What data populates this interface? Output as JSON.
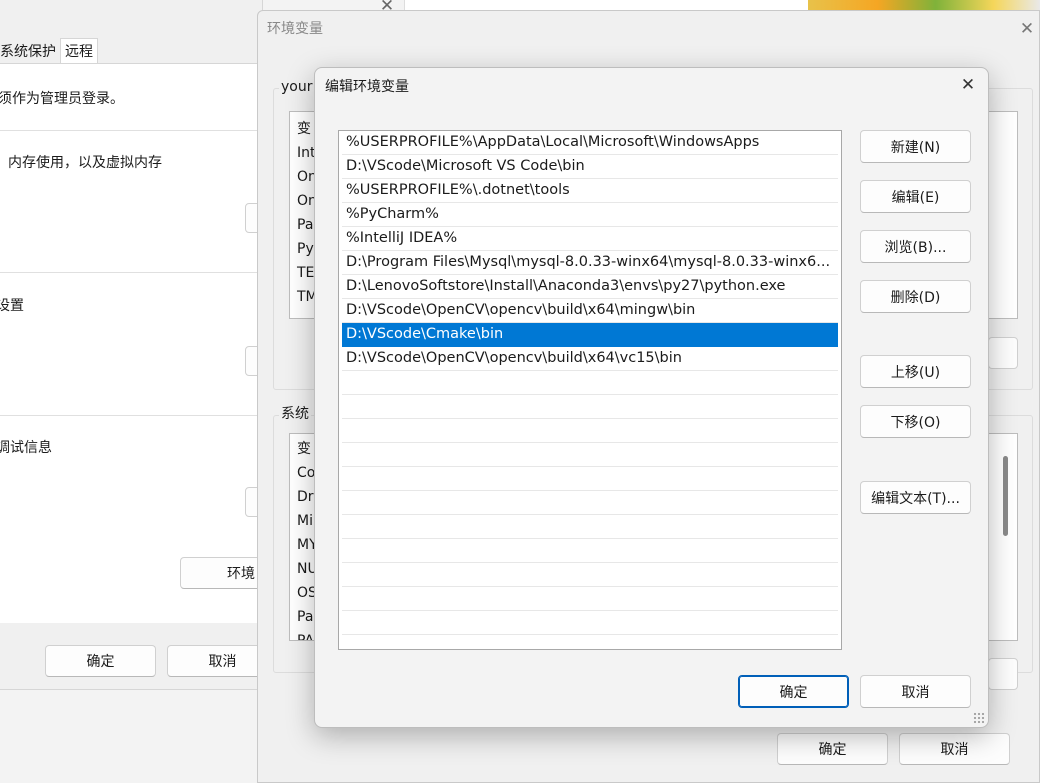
{
  "system_properties": {
    "tabs": [
      "系统保护",
      "远程"
    ],
    "admin_notice": "须作为管理员登录。",
    "performance_text": "内存使用，以及虚拟内存",
    "profiles_text": "设置",
    "startup_text": "调试信息",
    "env_button": "环境",
    "ok": "确定",
    "cancel": "取消"
  },
  "environment_variables": {
    "title": "环境变量",
    "user_group_label": "your",
    "user_vars_header": "变",
    "user_vars": [
      "Int",
      "On",
      "On",
      "Pa",
      "Py",
      "TE",
      "TM"
    ],
    "system_group_label": "系统",
    "system_vars_header": "变",
    "system_vars": [
      "Co",
      "Dr",
      "Mi",
      "MY",
      "NU",
      "OS",
      "Pa",
      "PA"
    ],
    "ok": "确定",
    "cancel": "取消"
  },
  "edit_dialog": {
    "title": "编辑环境变量",
    "paths": [
      "%USERPROFILE%\\AppData\\Local\\Microsoft\\WindowsApps",
      "D:\\VScode\\Microsoft VS Code\\bin",
      "%USERPROFILE%\\.dotnet\\tools",
      "%PyCharm%",
      "%IntelliJ IDEA%",
      "D:\\Program Files\\Mysql\\mysql-8.0.33-winx64\\mysql-8.0.33-winx6...",
      "D:\\LenovoSoftstore\\Install\\Anaconda3\\envs\\py27\\python.exe",
      "D:\\VScode\\OpenCV\\opencv\\build\\x64\\mingw\\bin",
      "D:\\VScode\\Cmake\\bin",
      "D:\\VScode\\OpenCV\\opencv\\build\\x64\\vc15\\bin"
    ],
    "selected_path": "D:\\VScode\\Cmake\\bin",
    "buttons": {
      "new": "新建(N)",
      "edit": "编辑(E)",
      "browse": "浏览(B)...",
      "delete": "删除(D)",
      "move_up": "上移(U)",
      "move_down": "下移(O)",
      "edit_text": "编辑文本(T)..."
    },
    "ok": "确定",
    "cancel": "取消"
  },
  "icons": {
    "close": "close-icon",
    "resize_grip": "resize-grip-icon"
  },
  "colors": {
    "accent": "#0078d4",
    "primary_border": "#005fb8"
  }
}
